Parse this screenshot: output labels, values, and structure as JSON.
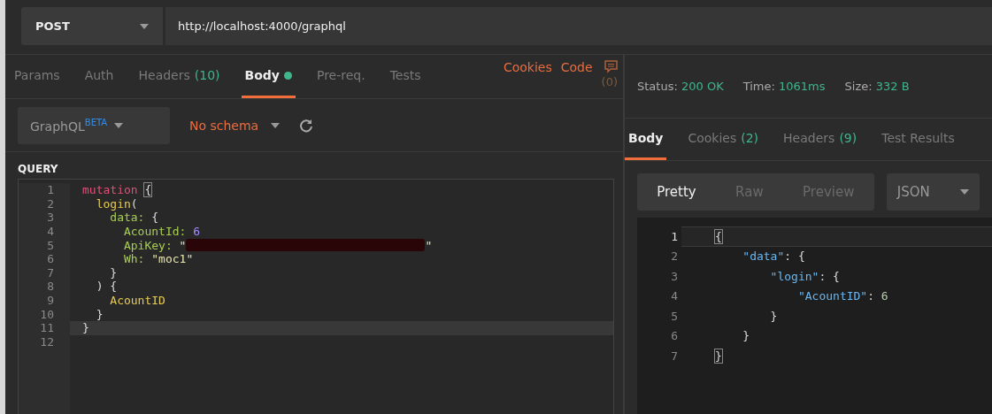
{
  "request_bar": {
    "method": "POST",
    "url": "http://localhost:4000/graphql"
  },
  "request_tabs": [
    {
      "label": "Params",
      "dot": false,
      "selected": false
    },
    {
      "label": "Auth",
      "dot": false,
      "selected": false
    },
    {
      "label": "Headers",
      "count": "(10)",
      "dot": false,
      "selected": false
    },
    {
      "label": "Body",
      "dot": true,
      "selected": true
    },
    {
      "label": "Pre-req.",
      "dot": false,
      "selected": false
    },
    {
      "label": "Tests",
      "dot": false,
      "selected": false
    }
  ],
  "request_links": [
    "Cookies",
    "Code"
  ],
  "comments_count": "(0)",
  "body_type": {
    "label": "GraphQL",
    "badge": "BETA"
  },
  "schema": {
    "label": "No schema"
  },
  "query_label": "QUERY",
  "query_lines": [
    {
      "number": "1",
      "current": false,
      "tokens": [
        {
          "kind": "keyword",
          "text": "mutation "
        },
        {
          "kind": "match",
          "text": "{"
        }
      ]
    },
    {
      "number": "2",
      "current": false,
      "tokens": [
        {
          "kind": "field",
          "text": "  login"
        },
        {
          "kind": "punct",
          "text": "("
        }
      ]
    },
    {
      "number": "3",
      "current": false,
      "tokens": [
        {
          "kind": "arg",
          "text": "    data:"
        },
        {
          "kind": "punct",
          "text": " {"
        }
      ]
    },
    {
      "number": "4",
      "current": false,
      "tokens": [
        {
          "kind": "arg",
          "text": "      AcountId:"
        },
        {
          "kind": "number",
          "text": " 6"
        }
      ]
    },
    {
      "number": "5",
      "current": false,
      "tokens": [
        {
          "kind": "arg",
          "text": "      ApiKey:"
        },
        {
          "kind": "string",
          "text": " \""
        },
        {
          "kind": "redaction"
        },
        {
          "kind": "string",
          "text": "\""
        }
      ]
    },
    {
      "number": "6",
      "current": false,
      "tokens": [
        {
          "kind": "arg",
          "text": "      Wh:"
        },
        {
          "kind": "string",
          "text": " \"moc1\""
        }
      ]
    },
    {
      "number": "7",
      "current": false,
      "tokens": [
        {
          "kind": "punct",
          "text": "    }"
        }
      ]
    },
    {
      "number": "8",
      "current": false,
      "tokens": [
        {
          "kind": "punct",
          "text": "  ) {"
        }
      ]
    },
    {
      "number": "9",
      "current": false,
      "tokens": [
        {
          "kind": "field",
          "text": "    AcountID"
        }
      ]
    },
    {
      "number": "10",
      "current": false,
      "tokens": [
        {
          "kind": "punct",
          "text": "  }"
        }
      ]
    },
    {
      "number": "11",
      "current": true,
      "tokens": [
        {
          "kind": "punct",
          "text": "}"
        }
      ]
    },
    {
      "number": "12",
      "current": false
    }
  ],
  "status": [
    {
      "label": "Status:",
      "value": "200 OK"
    },
    {
      "label": "Time:",
      "value": "1061ms"
    },
    {
      "label": "Size:",
      "value": "332 B"
    }
  ],
  "response_tabs": [
    {
      "label": "Body",
      "selected": true
    },
    {
      "label": "Cookies",
      "count": "(2)",
      "selected": false
    },
    {
      "label": "Headers",
      "count": "(9)",
      "selected": false
    },
    {
      "label": "Test Results",
      "selected": false
    }
  ],
  "view_modes": [
    {
      "label": "Pretty",
      "selected": true
    },
    {
      "label": "Raw",
      "selected": false
    },
    {
      "label": "Preview",
      "selected": false
    }
  ],
  "format": "JSON",
  "response_lines": [
    {
      "number": "1",
      "current": true,
      "tokens": [
        {
          "kind": "match",
          "text": "{"
        }
      ]
    },
    {
      "number": "2",
      "current": false,
      "tokens": [
        {
          "kind": "jkey",
          "text": "    \"data\""
        },
        {
          "kind": "punct",
          "text": ": {"
        }
      ]
    },
    {
      "number": "3",
      "current": false,
      "tokens": [
        {
          "kind": "jkey",
          "text": "        \"login\""
        },
        {
          "kind": "punct",
          "text": ": {"
        }
      ]
    },
    {
      "number": "4",
      "current": false,
      "tokens": [
        {
          "kind": "jkey",
          "text": "            \"AcountID\""
        },
        {
          "kind": "punct",
          "text": ": "
        },
        {
          "kind": "jnumber",
          "text": "6"
        }
      ]
    },
    {
      "number": "5",
      "current": false,
      "tokens": [
        {
          "kind": "punct",
          "text": "        }"
        }
      ]
    },
    {
      "number": "6",
      "current": false,
      "tokens": [
        {
          "kind": "punct",
          "text": "    }"
        }
      ]
    },
    {
      "number": "7",
      "current": false,
      "tokens": [
        {
          "kind": "match",
          "text": "}"
        }
      ]
    }
  ]
}
